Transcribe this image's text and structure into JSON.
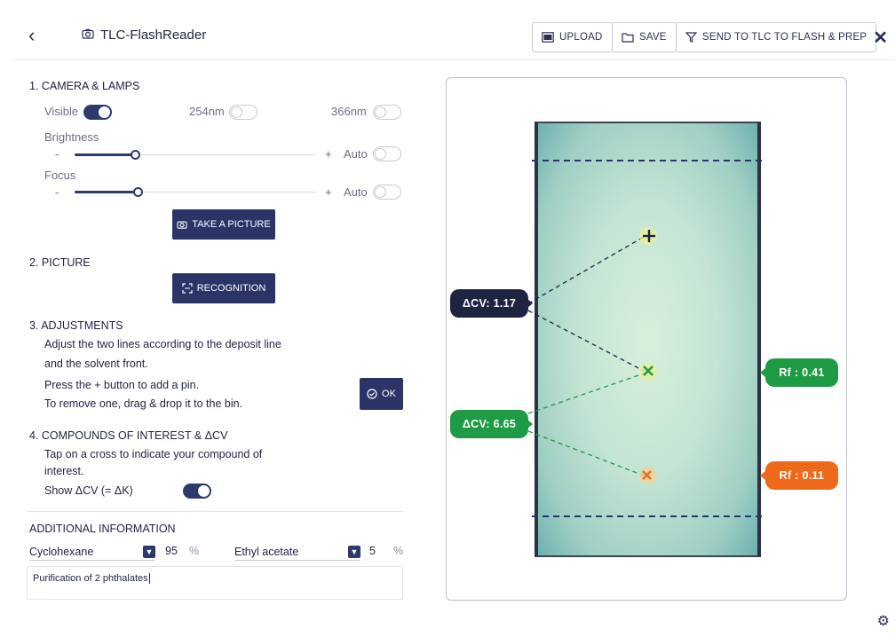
{
  "app": {
    "title": "TLC-FlashReader"
  },
  "header": {
    "upload_label": "UPLOAD",
    "save_label": "SAVE",
    "send_label": "SEND TO TLC TO FLASH & PREP"
  },
  "camera": {
    "heading": "1. CAMERA & LAMPS",
    "visible_label": "Visible",
    "uv254_label": "254nm",
    "uv366_label": "366nm",
    "visible_on": true,
    "uv254_on": false,
    "uv366_on": false,
    "brightness_label": "Brightness",
    "focus_label": "Focus",
    "minus": "-",
    "plus": "+",
    "auto_label": "Auto",
    "brightness_level": 0.25,
    "focus_level": 0.26,
    "take_picture_label": "TAKE A PICTURE"
  },
  "picture": {
    "heading": "2. PICTURE",
    "recognition_label": "RECOGNITION"
  },
  "adjustments": {
    "heading": "3. ADJUSTMENTS",
    "line1": "Adjust the two lines according to the deposit line",
    "line2": "and the solvent front.",
    "line3": "Press the + button to add a pin.",
    "line4": "To remove one, drag & drop it to the bin.",
    "ok_label": "OK"
  },
  "compounds": {
    "heading": "4. COMPOUNDS OF INTEREST & ΔCV",
    "line1": "Tap on a cross to indicate your compound of",
    "line2": "interest.",
    "show_label": "Show ΔCV (= ΔK)",
    "show_on": true
  },
  "additional": {
    "heading": "ADDITIONAL INFORMATION",
    "solvent1": "Cyclohexane",
    "solvent1_pct": "95",
    "solvent2": "Ethyl acetate",
    "solvent2_pct": "5",
    "pct_sign": "%",
    "notes": "Purification of 2 phthalates"
  },
  "plate": {
    "dcv1_label": "ΔCV: 1.17",
    "dcv2_label": "ΔCV: 6.65",
    "rf1_label": "Rf : 0.41",
    "rf2_label": "Rf : 0.11",
    "colors": {
      "dark": "#1d2340",
      "green": "#1f9a45",
      "orange": "#ee6a1a",
      "line": "#2b3466"
    }
  }
}
